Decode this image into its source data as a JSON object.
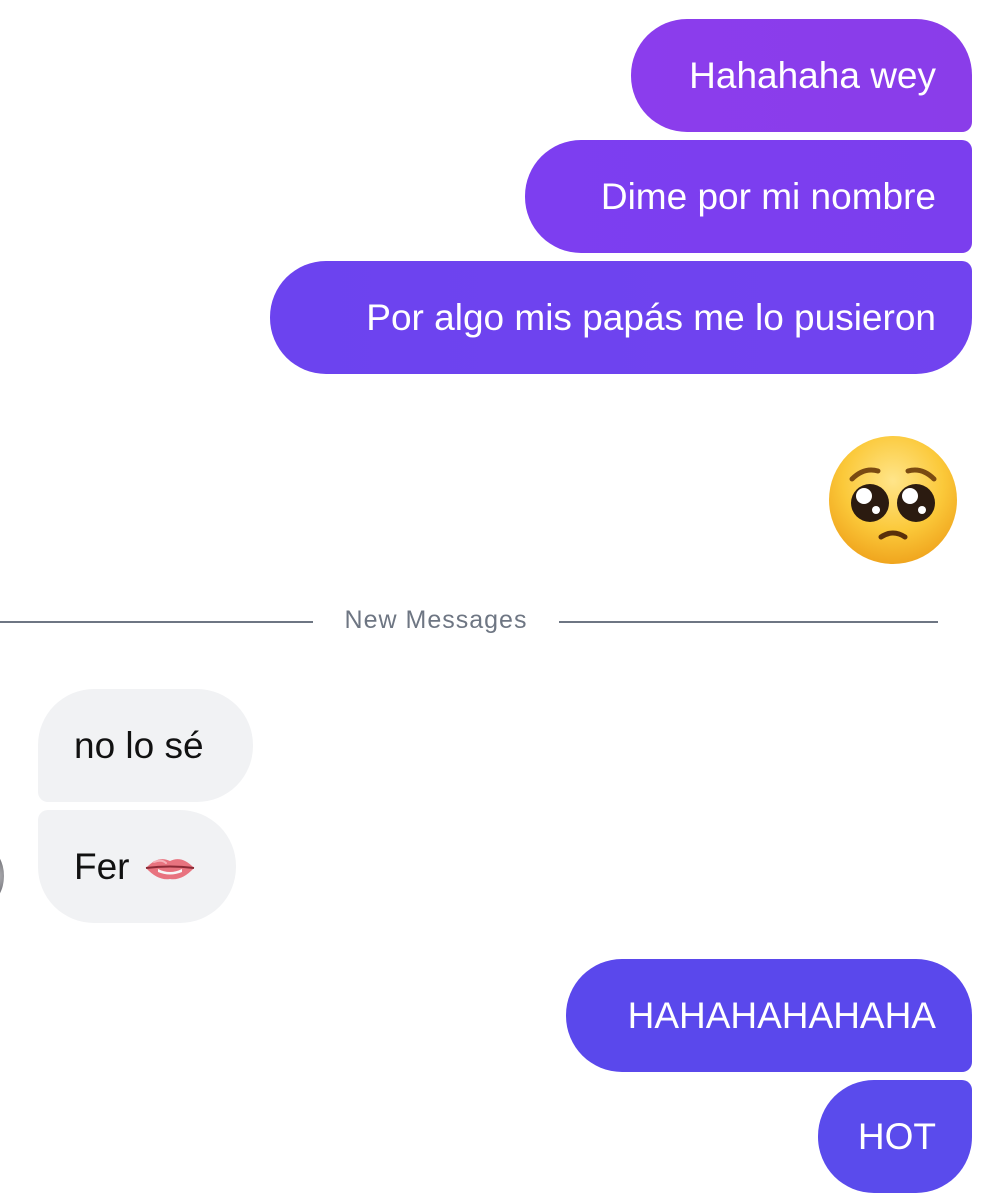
{
  "messages": {
    "sent_1": "Hahahaha wey",
    "sent_2": "Dime por mi nombre",
    "sent_3": "Por algo mis papás me lo pusieron",
    "sent_4": "HAHAHAHAHAHA",
    "sent_5": "HOT",
    "received_1": "no lo sé",
    "received_2": "Fer"
  },
  "emojis": {
    "pleading_face": "pleading-face-icon",
    "lips": "biting-lip-icon"
  },
  "divider": {
    "label": "New Messages"
  },
  "colors": {
    "sent_gradient_top": "#8b3ded",
    "sent_gradient_bottom": "#5a4bec",
    "received_bubble": "#f1f2f4",
    "divider": "#6e7683"
  }
}
